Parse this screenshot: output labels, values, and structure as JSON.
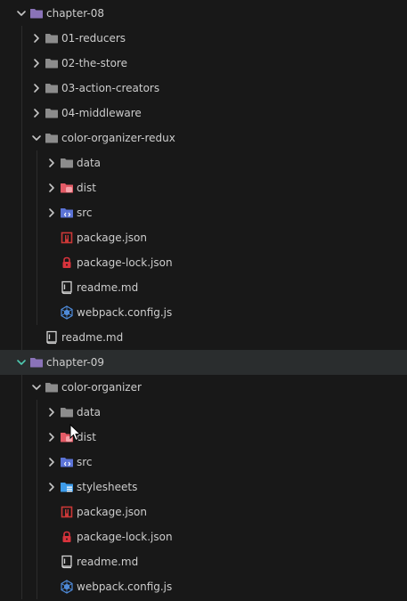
{
  "explorer": {
    "rows": [
      {
        "label": "chapter-08",
        "kind": "folder-open",
        "icon": "folder-purple-icon",
        "depth": 0
      },
      {
        "label": "01-reducers",
        "kind": "folder-closed",
        "icon": "folder-gray-icon",
        "depth": 1
      },
      {
        "label": "02-the-store",
        "kind": "folder-closed",
        "icon": "folder-gray-icon",
        "depth": 1
      },
      {
        "label": "03-action-creators",
        "kind": "folder-closed",
        "icon": "folder-gray-icon",
        "depth": 1
      },
      {
        "label": "04-middleware",
        "kind": "folder-closed",
        "icon": "folder-gray-icon",
        "depth": 1
      },
      {
        "label": "color-organizer-redux",
        "kind": "folder-open",
        "icon": "folder-gray-icon",
        "depth": 1
      },
      {
        "label": "data",
        "kind": "folder-closed",
        "icon": "folder-gray-icon",
        "depth": 2
      },
      {
        "label": "dist",
        "kind": "folder-closed",
        "icon": "folder-dist-icon",
        "depth": 2
      },
      {
        "label": "src",
        "kind": "folder-closed",
        "icon": "folder-src-icon",
        "depth": 2
      },
      {
        "label": "package.json",
        "kind": "file",
        "icon": "npm-icon",
        "depth": 2
      },
      {
        "label": "package-lock.json",
        "kind": "file",
        "icon": "lock-icon",
        "depth": 2
      },
      {
        "label": "readme.md",
        "kind": "file",
        "icon": "readme-icon",
        "depth": 2
      },
      {
        "label": "webpack.config.js",
        "kind": "file",
        "icon": "webpack-icon",
        "depth": 2
      },
      {
        "label": "readme.md",
        "kind": "file",
        "icon": "readme-icon",
        "depth": 1
      },
      {
        "label": "chapter-09",
        "kind": "folder-open",
        "icon": "folder-purple-icon",
        "depth": 0,
        "selected": true
      },
      {
        "label": "color-organizer",
        "kind": "folder-open",
        "icon": "folder-gray-icon",
        "depth": 1
      },
      {
        "label": "data",
        "kind": "folder-closed",
        "icon": "folder-gray-icon",
        "depth": 2
      },
      {
        "label": "dist",
        "kind": "folder-closed",
        "icon": "folder-dist-icon",
        "depth": 2
      },
      {
        "label": "src",
        "kind": "folder-closed",
        "icon": "folder-src-icon",
        "depth": 2
      },
      {
        "label": "stylesheets",
        "kind": "folder-closed",
        "icon": "folder-styles-icon",
        "depth": 2
      },
      {
        "label": "package.json",
        "kind": "file",
        "icon": "npm-icon",
        "depth": 2
      },
      {
        "label": "package-lock.json",
        "kind": "file",
        "icon": "lock-icon",
        "depth": 2
      },
      {
        "label": "readme.md",
        "kind": "file",
        "icon": "readme-icon",
        "depth": 2
      },
      {
        "label": "webpack.config.js",
        "kind": "file",
        "icon": "webpack-icon",
        "depth": 2
      }
    ]
  },
  "colors": {
    "background": "#181818",
    "selected_row": "#2a2d2e",
    "text": "#cccccc",
    "folder_purple": "#8a73b8",
    "folder_gray": "#8c8c8c",
    "dist_red": "#e35b66",
    "src_blue": "#5b73d6",
    "styles_blue": "#3d9be9",
    "npm_red": "#cb3837",
    "lock_red": "#d8333c",
    "webpack_blue": "#4e8ad8"
  }
}
